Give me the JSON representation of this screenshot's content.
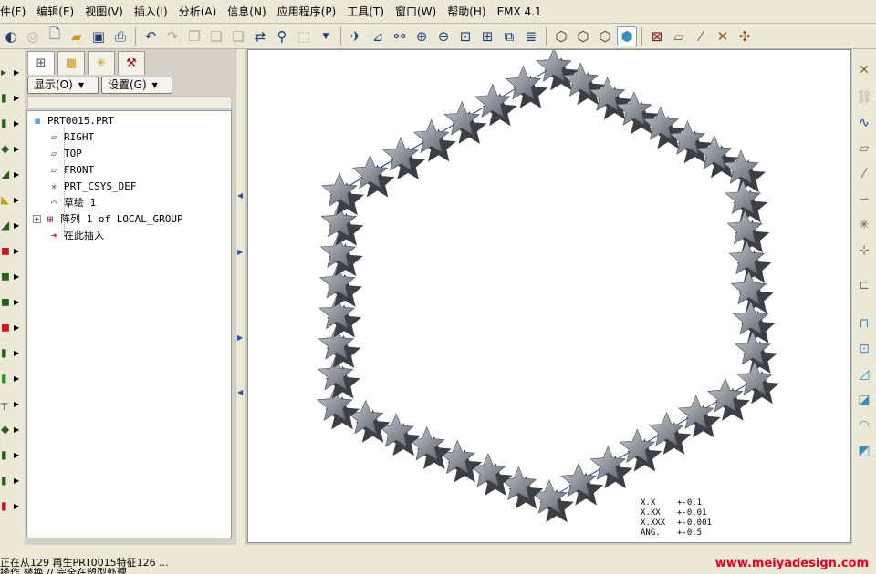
{
  "menu": [
    "件(F)",
    "编辑(E)",
    "视图(V)",
    "插入(I)",
    "分析(A)",
    "信息(N)",
    "应用程序(P)",
    "工具(T)",
    "窗口(W)",
    "帮助(H)",
    "EMX 4.1"
  ],
  "navigator": {
    "show_label": "显示(O)",
    "settings_label": "设置(G)",
    "tree": [
      {
        "label": "PRT0015.PRT",
        "icon": "part-icon"
      },
      {
        "label": "RIGHT",
        "icon": "datum-plane-icon"
      },
      {
        "label": "TOP",
        "icon": "datum-plane-icon"
      },
      {
        "label": "FRONT",
        "icon": "datum-plane-icon"
      },
      {
        "label": "PRT_CSYS_DEF",
        "icon": "csys-icon"
      },
      {
        "label": "草绘 1",
        "icon": "sketch-icon"
      },
      {
        "label": "阵列 1 of LOCAL_GROUP",
        "icon": "pattern-icon"
      },
      {
        "label": "在此插入",
        "icon": "insert-here-icon"
      }
    ]
  },
  "tolerances": [
    {
      "key": "X.X",
      "value": "+-0.1"
    },
    {
      "key": "X.XX",
      "value": "+-0.01"
    },
    {
      "key": "X.XXX",
      "value": "+-0.001"
    },
    {
      "key": "ANG.",
      "value": "+-0.5"
    }
  ],
  "messages": [
    "正在从129 再生PRT0015特征126 ...",
    "操作 替换 // 完全在塑型处理"
  ],
  "watermark": "www.meiyadesign.com",
  "colors": {
    "accent": "#1f3a9a",
    "watermark": "#e8001c",
    "star_fill": "#8a9099"
  }
}
